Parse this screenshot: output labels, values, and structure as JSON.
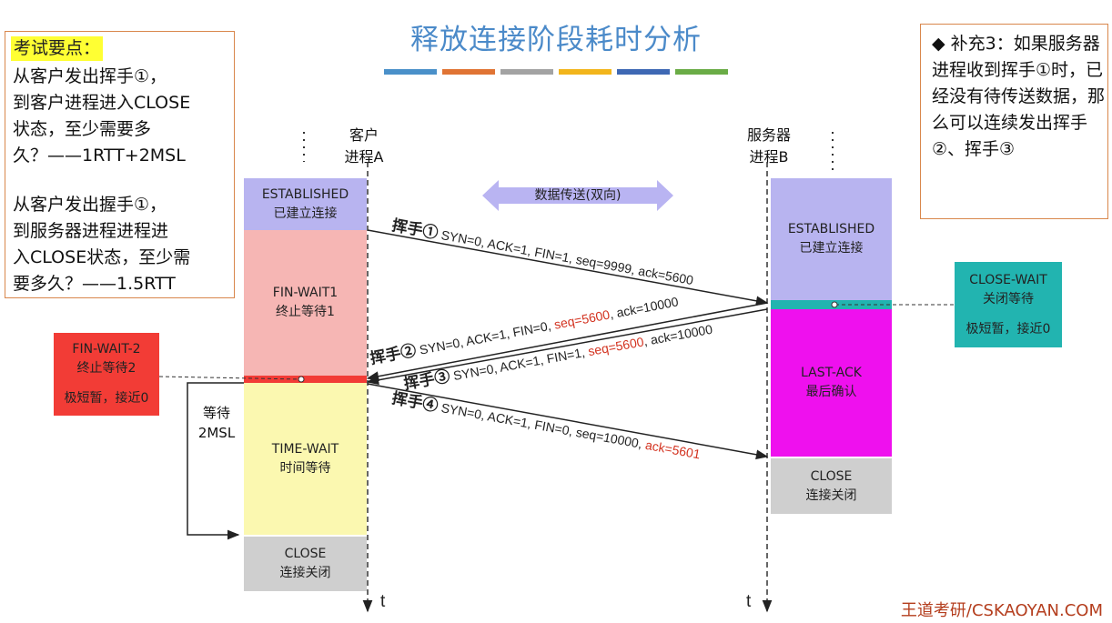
{
  "title": "释放连接阶段耗时分析",
  "title_bar_colors": [
    "#4a90c9",
    "#e07434",
    "#a3a3a3",
    "#f2b51c",
    "#3e68b4",
    "#6aac46"
  ],
  "exam_note": {
    "heading": "考试要点：",
    "q1": [
      "从客户发出挥手①，",
      "到客户进程进入CLOSE",
      "状态，至少需要多",
      "久？——1RTT+2MSL"
    ],
    "q2": [
      "从客户发出握手①，",
      "到服务器进程进程进",
      "入CLOSE状态，至少需",
      "要多久？——1.5RTT"
    ]
  },
  "supplement": {
    "bullet": "◆",
    "text": "补充3：如果服务器进程收到挥手①时，已经没有待传送数据，那么可以连续发出挥手②、挥手③"
  },
  "client": {
    "label_line1": "客户",
    "label_line2": "进程A",
    "axis": "t"
  },
  "server": {
    "label_line1": "服务器",
    "label_line2": "进程B",
    "axis": "t"
  },
  "client_states": {
    "established": {
      "en": "ESTABLISHED",
      "zh": "已建立连接",
      "color": "#b8b4f0"
    },
    "fin_wait1": {
      "en": "FIN-WAIT1",
      "zh": "终止等待1",
      "color": "#f6b6b4"
    },
    "time_wait": {
      "en": "TIME-WAIT",
      "zh": "时间等待",
      "color": "#fbf8b0"
    },
    "close": {
      "en": "CLOSE",
      "zh": "连接关闭",
      "color": "#cfcfcf"
    }
  },
  "server_states": {
    "established": {
      "en": "ESTABLISHED",
      "zh": "已建立连接",
      "color": "#b8b4f0"
    },
    "last_ack": {
      "en": "LAST-ACK",
      "zh": "最后确认",
      "color": "#ef10ee"
    },
    "close": {
      "en": "CLOSE",
      "zh": "连接关闭",
      "color": "#cfcfcf"
    }
  },
  "fin_wait2": {
    "en": "FIN-WAIT-2",
    "zh": "终止等待2",
    "note": "极短暂，接近0",
    "color": "#f23c36"
  },
  "close_wait": {
    "en": "CLOSE-WAIT",
    "zh": "关闭等待",
    "note": "极短暂，接近0",
    "color": "#22b4b0"
  },
  "wait_2msl": {
    "line1": "等待",
    "line2": "2MSL"
  },
  "data_transfer": "数据传送(双向)",
  "messages": {
    "m1": {
      "label": "挥手①",
      "text": "SYN=0, ACK=1, FIN=1, seq=9999, ack=5600"
    },
    "m2": {
      "label": "挥手②",
      "pre": "SYN=0, ACK=1, FIN=0, ",
      "hl": "seq=5600",
      "post": ", ack=10000"
    },
    "m3": {
      "label": "挥手③",
      "pre": "SYN=0, ACK=1, FIN=1, ",
      "hl": "seq=5600",
      "post": ", ack=10000"
    },
    "m4": {
      "label": "挥手④",
      "pre": "SYN=0, ACK=1, FIN=0, seq=10000, ",
      "hl": "ack=5601"
    }
  },
  "brand": "王道考研/CSKAOYAN.COM"
}
